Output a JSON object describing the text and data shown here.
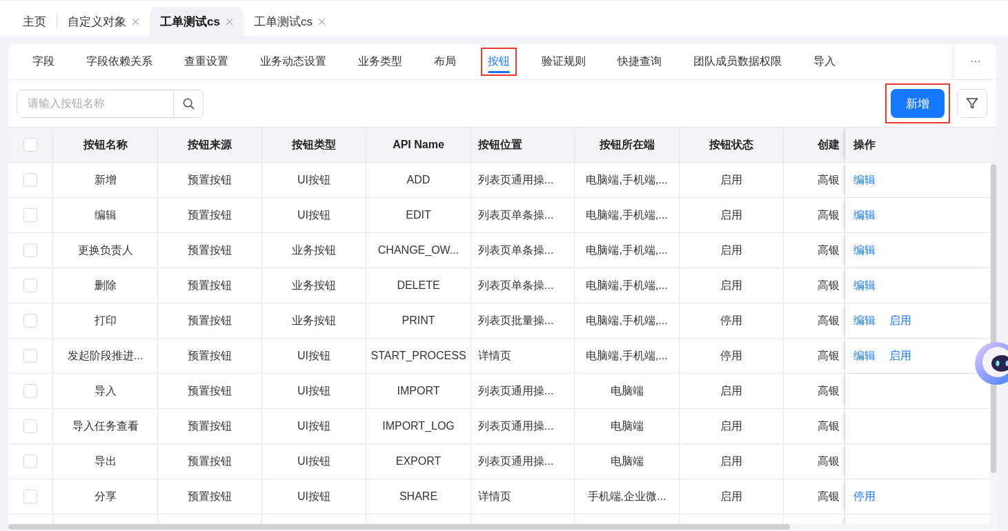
{
  "top_tabs": [
    {
      "label": "主页",
      "selected": false,
      "closable": false
    },
    {
      "label": "自定义对象",
      "selected": false,
      "closable": true
    },
    {
      "label": "工单测试cs",
      "selected": true,
      "closable": true
    },
    {
      "label": "工单测试cs",
      "selected": false,
      "closable": true
    }
  ],
  "sub_tabs": [
    {
      "label": "字段",
      "selected": false,
      "highlighted": false
    },
    {
      "label": "字段依赖关系",
      "selected": false,
      "highlighted": false
    },
    {
      "label": "查重设置",
      "selected": false,
      "highlighted": false
    },
    {
      "label": "业务动态设置",
      "selected": false,
      "highlighted": false
    },
    {
      "label": "业务类型",
      "selected": false,
      "highlighted": false
    },
    {
      "label": "布局",
      "selected": false,
      "highlighted": false
    },
    {
      "label": "按钮",
      "selected": true,
      "highlighted": true
    },
    {
      "label": "验证规则",
      "selected": false,
      "highlighted": false
    },
    {
      "label": "快捷查询",
      "selected": false,
      "highlighted": false
    },
    {
      "label": "团队成员数据权限",
      "selected": false,
      "highlighted": false
    },
    {
      "label": "导入",
      "selected": false,
      "highlighted": false
    }
  ],
  "more_button": "···",
  "search": {
    "placeholder": "请输入按钮名称"
  },
  "add_button": {
    "label": "新增",
    "highlighted": true
  },
  "table": {
    "header_checked": false,
    "columns": [
      "按钮名称",
      "按钮来源",
      "按钮类型",
      "API Name",
      "按钮位置",
      "按钮所在端",
      "按钮状态",
      "创建",
      "操作"
    ],
    "rows": [
      {
        "checked": false,
        "cells": [
          "新增",
          "预置按钮",
          "UI按钮",
          "ADD",
          "列表页通用操...",
          "电脑端,手机端,...",
          "启用",
          "高银"
        ],
        "actions": [
          "编辑"
        ]
      },
      {
        "checked": false,
        "cells": [
          "编辑",
          "预置按钮",
          "UI按钮",
          "EDIT",
          "列表页单条操...",
          "电脑端,手机端,...",
          "启用",
          "高银"
        ],
        "actions": [
          "编辑"
        ]
      },
      {
        "checked": false,
        "cells": [
          "更换负责人",
          "预置按钮",
          "业务按钮",
          "CHANGE_OW...",
          "列表页单条操...",
          "电脑端,手机端,...",
          "启用",
          "高银"
        ],
        "actions": [
          "编辑"
        ]
      },
      {
        "checked": false,
        "cells": [
          "删除",
          "预置按钮",
          "业务按钮",
          "DELETE",
          "列表页单条操...",
          "电脑端,手机端,...",
          "启用",
          "高银"
        ],
        "actions": [
          "编辑"
        ]
      },
      {
        "checked": false,
        "cells": [
          "打印",
          "预置按钮",
          "业务按钮",
          "PRINT",
          "列表页批量操...",
          "电脑端,手机端,...",
          "停用",
          "高银"
        ],
        "actions": [
          "编辑",
          "启用"
        ]
      },
      {
        "checked": false,
        "cells": [
          "发起阶段推进...",
          "预置按钮",
          "UI按钮",
          "START_PROCESS",
          "详情页",
          "电脑端,手机端,...",
          "停用",
          "高银"
        ],
        "actions": [
          "编辑",
          "启用"
        ]
      },
      {
        "checked": false,
        "cells": [
          "导入",
          "预置按钮",
          "UI按钮",
          "IMPORT",
          "列表页通用操...",
          "电脑端",
          "启用",
          "高银"
        ],
        "actions": []
      },
      {
        "checked": false,
        "cells": [
          "导入任务查看",
          "预置按钮",
          "UI按钮",
          "IMPORT_LOG",
          "列表页通用操...",
          "电脑端",
          "启用",
          "高银"
        ],
        "actions": []
      },
      {
        "checked": false,
        "cells": [
          "导出",
          "预置按钮",
          "UI按钮",
          "EXPORT",
          "列表页通用操...",
          "电脑端",
          "启用",
          "高银"
        ],
        "actions": []
      },
      {
        "checked": false,
        "cells": [
          "分享",
          "预置按钮",
          "UI按钮",
          "SHARE",
          "详情页",
          "手机端,企业微...",
          "启用",
          "高银"
        ],
        "actions": [
          "停用"
        ]
      }
    ]
  }
}
